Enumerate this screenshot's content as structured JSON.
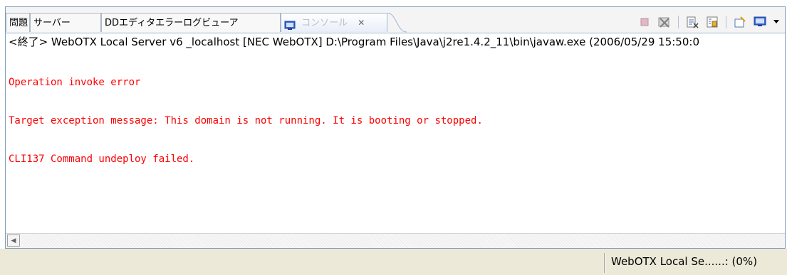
{
  "tabs": [
    {
      "label": "問題"
    },
    {
      "label": "サーバー"
    },
    {
      "label": "DDエディタエラーログビューア"
    },
    {
      "label": "コンソール",
      "active": true,
      "close": "✕"
    }
  ],
  "toolbar": {
    "icons": [
      "terminate-icon",
      "remove-launches-icon",
      "clear-console-icon",
      "scroll-lock-icon",
      "pin-console-icon",
      "display-console-icon",
      "view-menu-icon"
    ]
  },
  "console": {
    "description": "<終了> WebOTX Local Server v6  _localhost [NEC WebOTX] D:\\Program Files\\Java\\j2re1.4.2_11\\bin\\javaw.exe (2006/05/29 15:50:0",
    "lines": [
      "Operation invoke error",
      "Target exception message: This domain is not running. It is booting or stopped.",
      "CLI137 Command undeploy failed."
    ],
    "text_color": "#ff0000"
  },
  "status": {
    "text": "WebOTX Local Se......: (0%)"
  }
}
